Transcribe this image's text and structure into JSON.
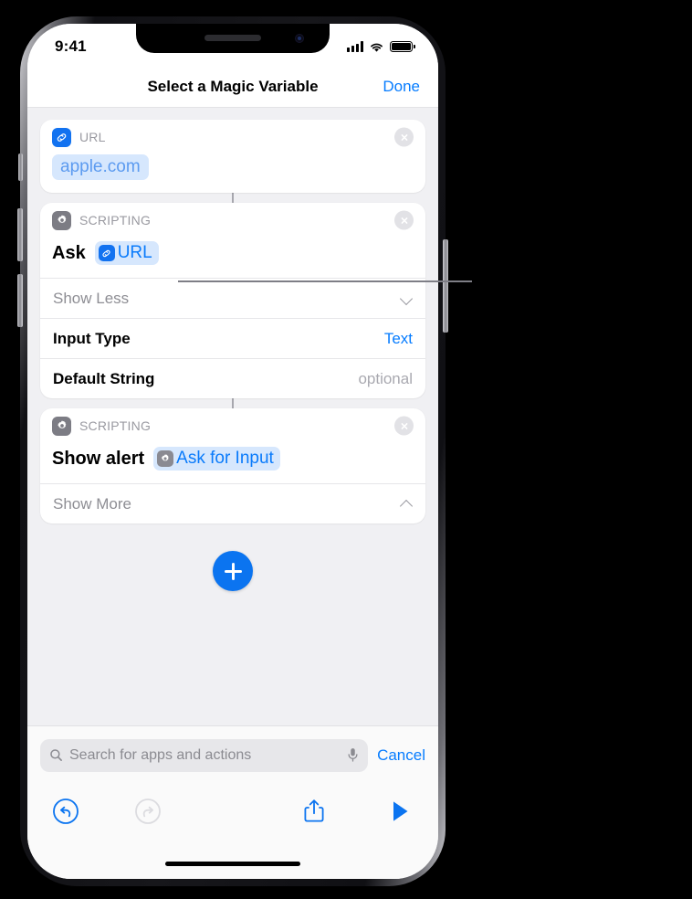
{
  "device": {
    "status_bar": {
      "time": "9:41",
      "signal_icon": "cellular-bars-icon",
      "wifi_icon": "wifi-icon",
      "battery_icon": "battery-full-icon"
    }
  },
  "nav": {
    "title": "Select a Magic Variable",
    "done_label": "Done"
  },
  "cards": [
    {
      "id": "url-card",
      "header_icon": "link-icon",
      "header_label": "URL",
      "close_icon": "close-icon",
      "value": "apple.com"
    },
    {
      "id": "ask-card",
      "header_icon": "gear-icon",
      "header_label": "SCRIPTING",
      "close_icon": "close-icon",
      "action_label": "Ask",
      "token_icon": "link-icon",
      "token_label": "URL",
      "disclosure_label": "Show Less",
      "disclosure_icon": "chevron-down-icon",
      "rows": [
        {
          "label": "Input Type",
          "value": "Text",
          "style": "link"
        },
        {
          "label": "Default String",
          "value": "optional",
          "style": "optional"
        }
      ]
    },
    {
      "id": "alert-card",
      "header_icon": "gear-icon",
      "header_label": "SCRIPTING",
      "close_icon": "close-icon",
      "action_label": "Show alert",
      "token_icon": "gear-icon",
      "token_label": "Ask for Input",
      "disclosure_label": "Show More",
      "disclosure_icon": "chevron-up-icon"
    }
  ],
  "add_button": {
    "icon": "plus-icon",
    "label": "Add Action"
  },
  "search": {
    "search_icon": "search-icon",
    "placeholder": "Search for apps and actions",
    "mic_icon": "microphone-icon",
    "cancel_label": "Cancel"
  },
  "toolbar": {
    "undo_icon": "undo-icon",
    "redo_icon": "redo-icon",
    "share_icon": "share-icon",
    "play_icon": "play-icon"
  },
  "colors": {
    "accent_blue": "#067cff",
    "token_blue": "#0a7bfb",
    "token_background": "#d6e7fd",
    "page_background": "#f0f0f3",
    "gear_gray": "#7c7c84",
    "leader_line": "#7e7e86"
  }
}
